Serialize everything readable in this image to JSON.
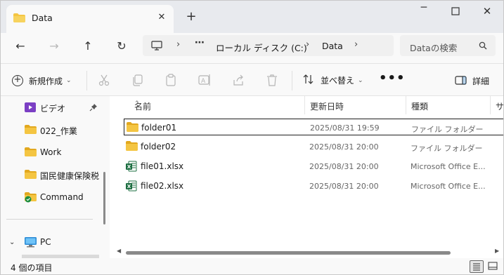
{
  "tab": {
    "title": "Data",
    "close_label": "✕",
    "new_tab_label": "+"
  },
  "window": {
    "minimize": "─",
    "maximize": "☐",
    "close": "✕"
  },
  "nav": {
    "back": "←",
    "forward": "→",
    "up": "↑",
    "refresh": "↻",
    "breadcrumb_sep": "›",
    "overflow": "⋯",
    "crumbs": [
      "ローカル ディスク (C:)",
      "Data"
    ],
    "search_placeholder": "Dataの検索"
  },
  "commands": {
    "new_label": "新規作成",
    "sort_label": "並べ替え",
    "more_label": "•••",
    "details_label": "詳細"
  },
  "sidebar": {
    "items": [
      {
        "label": "ビデオ",
        "icon": "video-folder-icon",
        "pinned": true
      },
      {
        "label": "022_作業",
        "icon": "folder-icon"
      },
      {
        "label": "Work",
        "icon": "folder-icon"
      },
      {
        "label": "国民健康保険税",
        "icon": "folder-icon"
      },
      {
        "label": "Command",
        "icon": "synced-folder-icon"
      }
    ],
    "pc_label": "PC",
    "expand_glyph": "⌄"
  },
  "columns": {
    "name": "名前",
    "date": "更新日時",
    "type": "種類",
    "size": "サイ"
  },
  "files": [
    {
      "name": "folder01",
      "date": "2025/08/31 19:59",
      "type": "ファイル フォルダー",
      "kind": "folder",
      "selected": true
    },
    {
      "name": "folder02",
      "date": "2025/08/31 20:00",
      "type": "ファイル フォルダー",
      "kind": "folder",
      "selected": false
    },
    {
      "name": "file01.xlsx",
      "date": "2025/08/31 20:00",
      "type": "Microsoft Office E...",
      "kind": "excel",
      "selected": false
    },
    {
      "name": "file02.xlsx",
      "date": "2025/08/31 20:00",
      "type": "Microsoft Office E...",
      "kind": "excel",
      "selected": false
    }
  ],
  "status": {
    "item_count": "4 個の項目"
  },
  "colors": {
    "folder": "#f4c542",
    "folder_dark": "#e2a81f",
    "excel": "#1d6f42",
    "accent": "#0067c0"
  }
}
